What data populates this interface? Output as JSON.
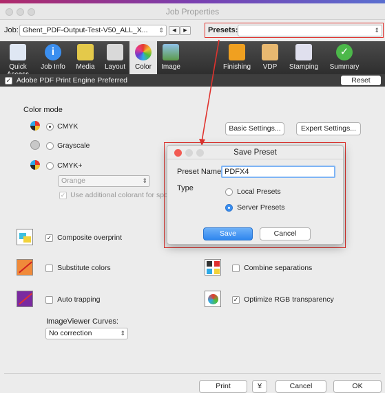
{
  "window": {
    "title": "Job Properties"
  },
  "job": {
    "label": "Job:",
    "value": "Ghent_PDF-Output-Test-V50_ALL_X...",
    "presets_label": "Presets:",
    "presets_value": ""
  },
  "toolbar": {
    "items": [
      {
        "label": "Quick Access",
        "icon": "document-icon"
      },
      {
        "label": "Job Info",
        "icon": "info-icon"
      },
      {
        "label": "Media",
        "icon": "media-icon"
      },
      {
        "label": "Layout",
        "icon": "layout-icon"
      },
      {
        "label": "Color",
        "icon": "color-wheel-icon",
        "active": true
      },
      {
        "label": "Image",
        "icon": "image-icon"
      },
      {
        "label": "Finishing",
        "icon": "finishing-icon"
      },
      {
        "label": "VDP",
        "icon": "vdp-icon"
      },
      {
        "label": "Stamping",
        "icon": "stamping-icon"
      },
      {
        "label": "Summary",
        "icon": "summary-check-icon"
      }
    ]
  },
  "engine": {
    "label": "Adobe PDF Print Engine Preferred",
    "checked": true,
    "reset_label": "Reset"
  },
  "color_mode": {
    "section_label": "Color mode",
    "options": [
      {
        "label": "CMYK",
        "selected": true
      },
      {
        "label": "Grayscale",
        "selected": false
      },
      {
        "label": "CMYK+",
        "selected": false
      }
    ],
    "cmyk_plus_select": "Orange",
    "additional_colorant_label": "Use additional colorant for spo",
    "basic_settings_label": "Basic Settings...",
    "expert_settings_label": "Expert Settings..."
  },
  "options": {
    "composite_overprint": {
      "label": "Composite overprint",
      "checked": true
    },
    "substitute_colors": {
      "label": "Substitute colors",
      "checked": false
    },
    "auto_trapping": {
      "label": "Auto trapping",
      "checked": false
    },
    "combine_separations": {
      "label": "Combine separations",
      "checked": false
    },
    "optimize_rgb": {
      "label": "Optimize RGB transparency",
      "checked": true
    }
  },
  "imageviewer": {
    "label": "ImageViewer Curves:",
    "value": "No correction"
  },
  "footer": {
    "print_label": "Print",
    "menu_glyph": "¥",
    "cancel_label": "Cancel",
    "ok_label": "OK"
  },
  "save_preset_dialog": {
    "title": "Save Preset",
    "preset_name_label": "Preset Name",
    "preset_name_value": "PDFX4",
    "type_label": "Type",
    "local_label": "Local Presets",
    "server_label": "Server Presets",
    "selected_type": "server",
    "save_label": "Save",
    "cancel_label": "Cancel"
  },
  "colors": {
    "accent_blue": "#3b8ff0",
    "highlight_red": "#e0332e",
    "toolbar_dark": "#3a3a3a"
  }
}
